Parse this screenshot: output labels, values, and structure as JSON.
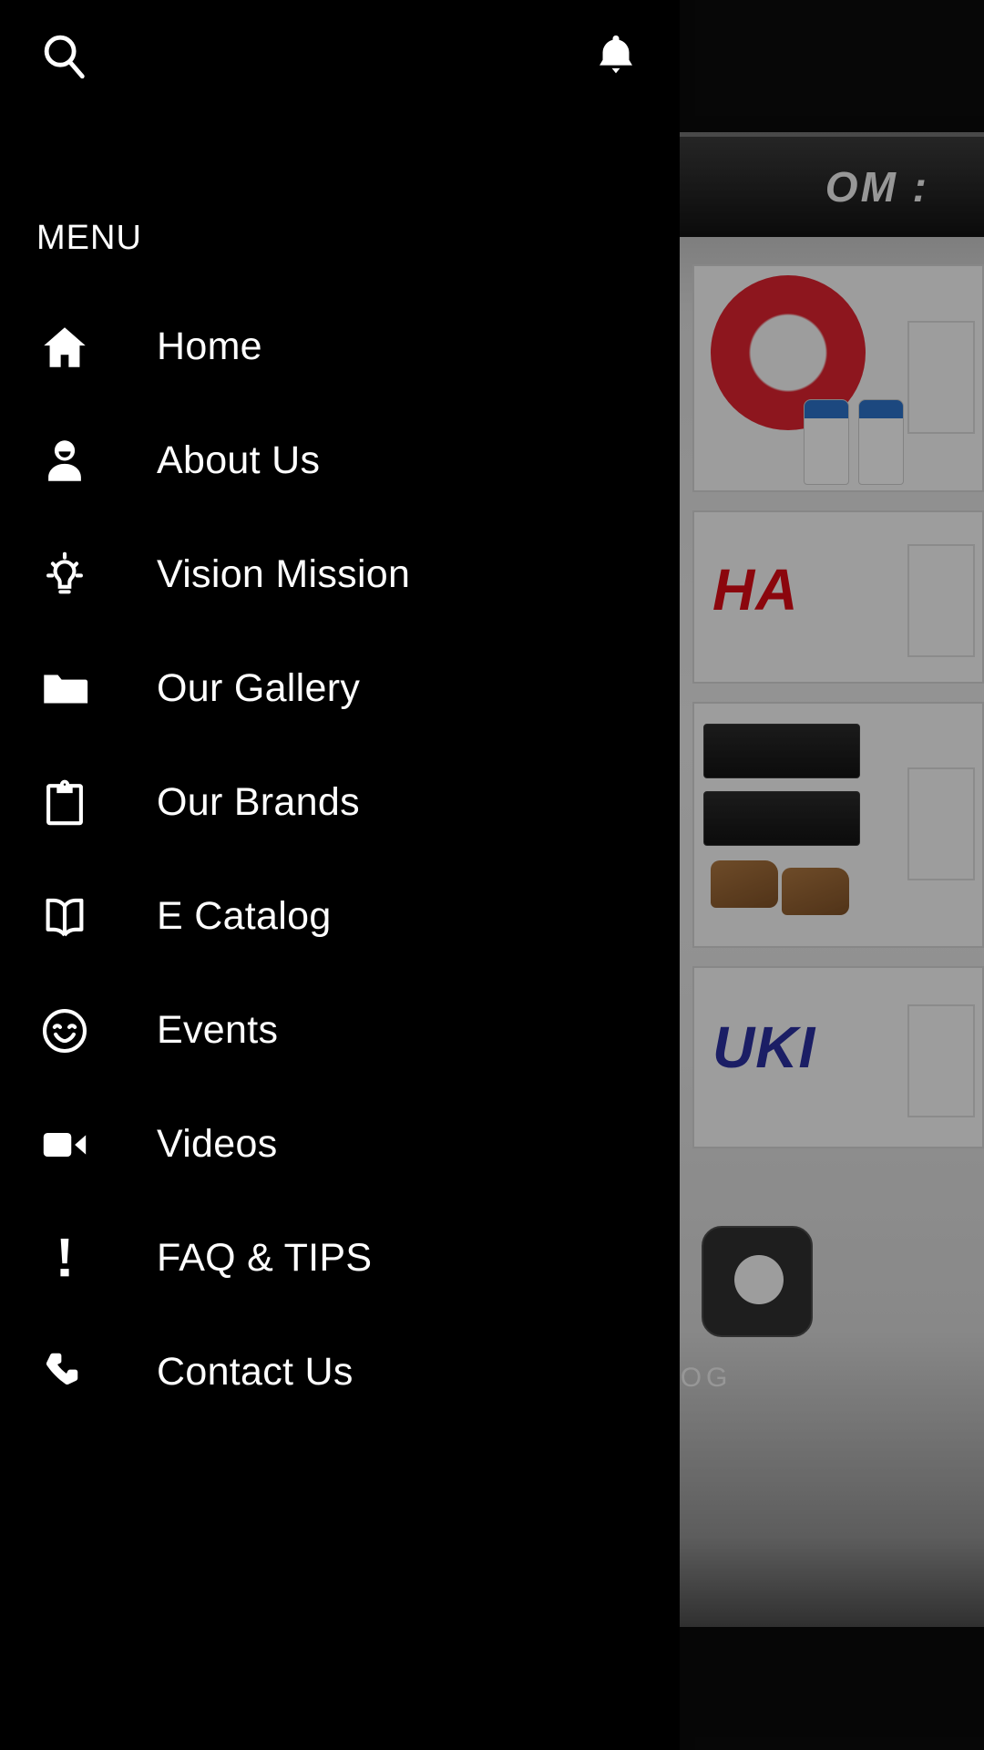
{
  "app": {
    "background_color": "#000000",
    "text_color": "#ffffff"
  },
  "topbar": {
    "search_icon": "search-icon",
    "notification_icon": "bell-icon"
  },
  "drawer": {
    "section_label": "MENU",
    "items": [
      {
        "label": "Home",
        "icon": "home-icon"
      },
      {
        "label": "About Us",
        "icon": "account-icon"
      },
      {
        "label": "Vision Mission",
        "icon": "lightbulb-icon"
      },
      {
        "label": "Our Gallery",
        "icon": "folder-icon"
      },
      {
        "label": "Our Brands",
        "icon": "clipboard-icon"
      },
      {
        "label": "E Catalog",
        "icon": "book-icon"
      },
      {
        "label": "Events",
        "icon": "smiley-icon"
      },
      {
        "label": "Videos",
        "icon": "video-camera-icon"
      },
      {
        "label": "FAQ & TIPS",
        "icon": "exclamation-icon"
      },
      {
        "label": "Contact Us",
        "icon": "phone-icon"
      }
    ]
  },
  "background": {
    "banner_text": "OM :",
    "brand_yamaha": "HA",
    "brand_suzuki": "UKI",
    "bottom_label": "ALOG"
  }
}
